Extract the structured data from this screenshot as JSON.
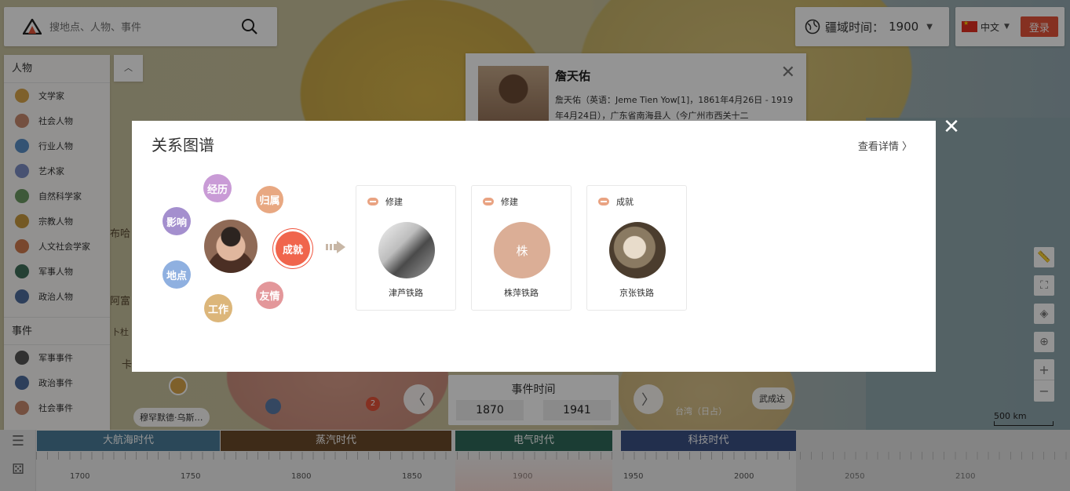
{
  "search": {
    "placeholder": "搜地点、人物、事件"
  },
  "header": {
    "time_label": "疆域时间：",
    "year": "1900",
    "lang": "中文",
    "login": "登录"
  },
  "sidebar": {
    "people_title": "人物",
    "people": [
      {
        "label": "文学家",
        "color": "#d9a54a"
      },
      {
        "label": "社会人物",
        "color": "#c98a6e"
      },
      {
        "label": "行业人物",
        "color": "#5b8fc7"
      },
      {
        "label": "艺术家",
        "color": "#7c8ec4"
      },
      {
        "label": "自然科学家",
        "color": "#6b9a62"
      },
      {
        "label": "宗教人物",
        "color": "#c89a3e"
      },
      {
        "label": "人文社会学家",
        "color": "#d07a4e"
      },
      {
        "label": "军事人物",
        "color": "#3f6e5a"
      },
      {
        "label": "政治人物",
        "color": "#4f6d9e"
      }
    ],
    "events_title": "事件",
    "events": [
      {
        "label": "军事事件",
        "color": "#555"
      },
      {
        "label": "政治事件",
        "color": "#4f6d9e"
      },
      {
        "label": "社会事件",
        "color": "#c98a6e"
      }
    ]
  },
  "detail": {
    "name": "詹天佑",
    "desc": "詹天佑（英语：Jeme Tien Yow[1]，1861年4月26日 - 1919年4月24日），广东省南海县人（今广州市西关十二"
  },
  "modal": {
    "title": "关系图谱",
    "more": "查看详情 〉",
    "bubbles": [
      {
        "label": "经历",
        "color": "#c99bd6"
      },
      {
        "label": "归属",
        "color": "#e8a882"
      },
      {
        "label": "影响",
        "color": "#a48fce"
      },
      {
        "label": "成就",
        "color": "#f0654c"
      },
      {
        "label": "地点",
        "color": "#8fb0e0"
      },
      {
        "label": "友情",
        "color": "#e3979a"
      },
      {
        "label": "工作",
        "color": "#dcb67a"
      }
    ],
    "cards": [
      {
        "type": "修建",
        "name": "津芦铁路",
        "pic_text": ""
      },
      {
        "type": "修建",
        "name": "株萍铁路",
        "pic_text": "株"
      },
      {
        "type": "成就",
        "name": "京张铁路",
        "pic_text": ""
      }
    ]
  },
  "map": {
    "labels": [
      "布哈",
      "阿富",
      "卜杜",
      "卡"
    ],
    "place_pill": "穆罕默德·乌斯…",
    "city_pill": "武成达",
    "island": "台湾（日占）",
    "badge": "2",
    "scale": "500 km"
  },
  "event_time": {
    "title": "事件时间",
    "start": "1870",
    "end": "1941"
  },
  "timeline": {
    "eras": [
      {
        "label": "大航海时代",
        "color": "#4a7d9a"
      },
      {
        "label": "蒸汽时代",
        "color": "#6b4a2a"
      },
      {
        "label": "电气时代",
        "color": "#2f6a5a"
      },
      {
        "label": "科技时代",
        "color": "#3b5286"
      }
    ],
    "ticks": [
      "1700",
      "1750",
      "1800",
      "1850",
      "1900",
      "1950",
      "2000",
      "2050",
      "2100"
    ]
  }
}
